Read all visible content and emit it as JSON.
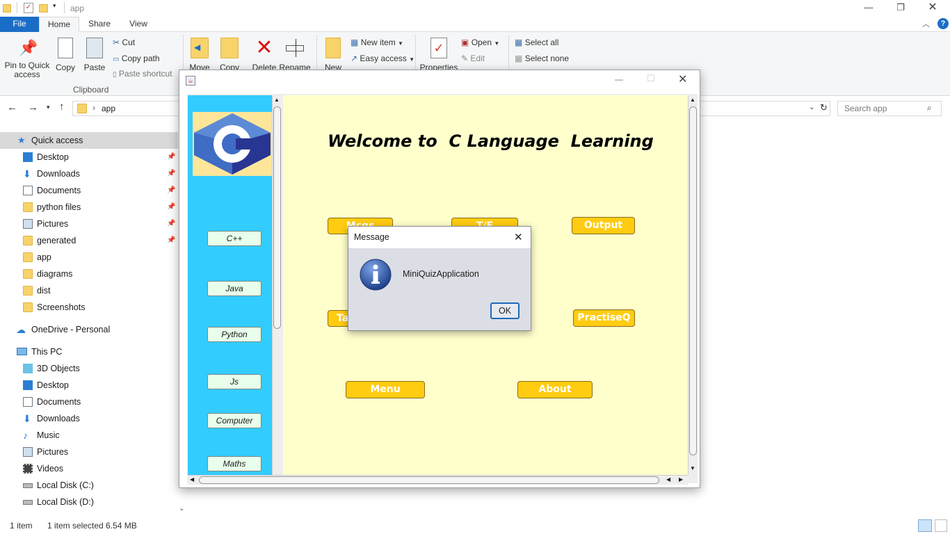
{
  "explorer": {
    "title": "app",
    "tabs": {
      "file": "File",
      "home": "Home",
      "share": "Share",
      "view": "View"
    },
    "ribbon": {
      "pin": "Pin to Quick access",
      "copy": "Copy",
      "paste": "Paste",
      "cut": "Cut",
      "copy_path": "Copy path",
      "paste_shortcut": "Paste shortcut",
      "clipboard": "Clipboard",
      "move": "Move",
      "copy_to": "Copy",
      "delete": "Delete",
      "rename": "Rename",
      "new": "New",
      "new_item": "New item",
      "easy_access": "Easy access",
      "properties": "Properties",
      "open": "Open",
      "edit": "Edit",
      "select_all": "Select all",
      "select_none": "Select none"
    },
    "address": {
      "path": "app",
      "search_placeholder": "Search app"
    },
    "nav": {
      "quick_access": "Quick access",
      "items": [
        "Desktop",
        "Downloads",
        "Documents",
        "python files",
        "Pictures",
        "generated",
        "app",
        "diagrams",
        "dist",
        "Screenshots"
      ],
      "onedrive": "OneDrive - Personal",
      "this_pc": "This PC",
      "pc_items": [
        "3D Objects",
        "Desktop",
        "Documents",
        "Downloads",
        "Music",
        "Pictures",
        "Videos",
        "Local Disk (C:)",
        "Local Disk (D:)"
      ]
    },
    "status": {
      "count": "1 item",
      "selected": "1 item selected  6.54 MB"
    }
  },
  "app": {
    "welcome": "Welcome to  C Language  Learning",
    "side_buttons": [
      "C++",
      "Java",
      "Python",
      "Js",
      "Computer",
      "Maths"
    ],
    "buttons": {
      "mcqs": "Mcqs",
      "tf": "T/F",
      "output": "Output",
      "ta": "Ta",
      "practise": "PractiseQ",
      "menu": "Menu",
      "about": "About"
    },
    "colors": {
      "side": "#33ccff",
      "main": "#ffffcc",
      "button": "#ffcc11"
    }
  },
  "dialog": {
    "title": "Message",
    "message": "MiniQuizApplication",
    "ok": "OK"
  }
}
